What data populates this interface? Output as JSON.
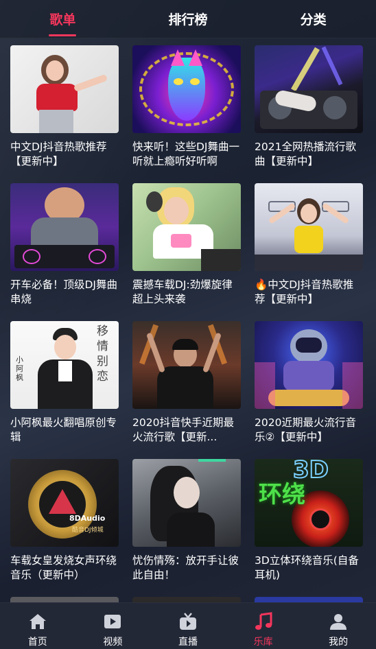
{
  "tabs": [
    {
      "label": "歌单",
      "active": true
    },
    {
      "label": "排行榜",
      "active": false
    },
    {
      "label": "分类",
      "active": false
    }
  ],
  "playlists": [
    {
      "title": "中文DJ抖音热歌推荐【更新中】"
    },
    {
      "title": "快来听！这些DJ舞曲一听就上瘾听好听啊"
    },
    {
      "title": "2021全网热播流行歌曲【更新中】"
    },
    {
      "title": "开车必备！顶级DJ舞曲串烧"
    },
    {
      "title": "震撼车载DJ:劲爆旋律超上头来袭"
    },
    {
      "title": "🔥中文DJ抖音热歌推荐【更新中】"
    },
    {
      "title": "小阿枫最火翻唱原创专辑"
    },
    {
      "title": "2020抖音快手近期最火流行歌【更新..."
    },
    {
      "title": "2020近期最火流行音乐②【更新中】"
    },
    {
      "title": "车载女皇发烧女声环绕音乐（更新中）"
    },
    {
      "title": "忧伤情殇：放开手让彼此自由！"
    },
    {
      "title": "3D立体环绕音乐(自备耳机)"
    }
  ],
  "thumb_text": {
    "cover7_name": "小阿枫",
    "cover7_title": "移情别恋",
    "cover10_brand": "8DAudio",
    "cover10_sub": "酷音DJ倾城",
    "cover12_big": "3D",
    "cover12_text": "环绕"
  },
  "bottom_nav": [
    {
      "label": "首页",
      "icon": "home-icon",
      "active": false
    },
    {
      "label": "视频",
      "icon": "video-icon",
      "active": false
    },
    {
      "label": "直播",
      "icon": "live-tv-icon",
      "active": false
    },
    {
      "label": "乐库",
      "icon": "music-note-icon",
      "active": true
    },
    {
      "label": "我的",
      "icon": "person-icon",
      "active": false
    }
  ],
  "colors": {
    "accent": "#f5365c",
    "nav_bg": "#232837",
    "page_bg": "#1e2535"
  }
}
